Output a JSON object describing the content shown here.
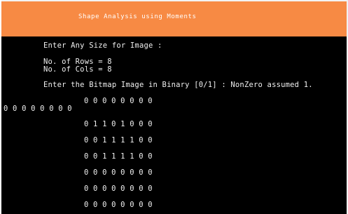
{
  "window": {
    "title": "Shape Analysis using Moments",
    "colors": {
      "title_bar": "#f78a44",
      "console_bg": "#000000",
      "text": "#f0f0f0"
    }
  },
  "console": {
    "prompt_size": "Enter Any Size for Image :",
    "rows_line": "No. of Rows = 8",
    "cols_line": "No. of Cols = 8",
    "bitmap_prompt": "Enter the Bitmap Image in Binary [0/1] : NonZero assumed 1.",
    "matrix_rows": [
      "0 0 0 0 0 0 0 0",
      "0 0 0 0 0 0 0 0",
      "0 1 1 0 1 0 0 0",
      "0 0 1 1 1 1 0 0",
      "0 0 1 1 1 1 0 0",
      "0 0 0 0 0 0 0 0",
      "0 0 0 0 0 0 0 0",
      "0 0 0 0 0 0 0 0"
    ]
  }
}
